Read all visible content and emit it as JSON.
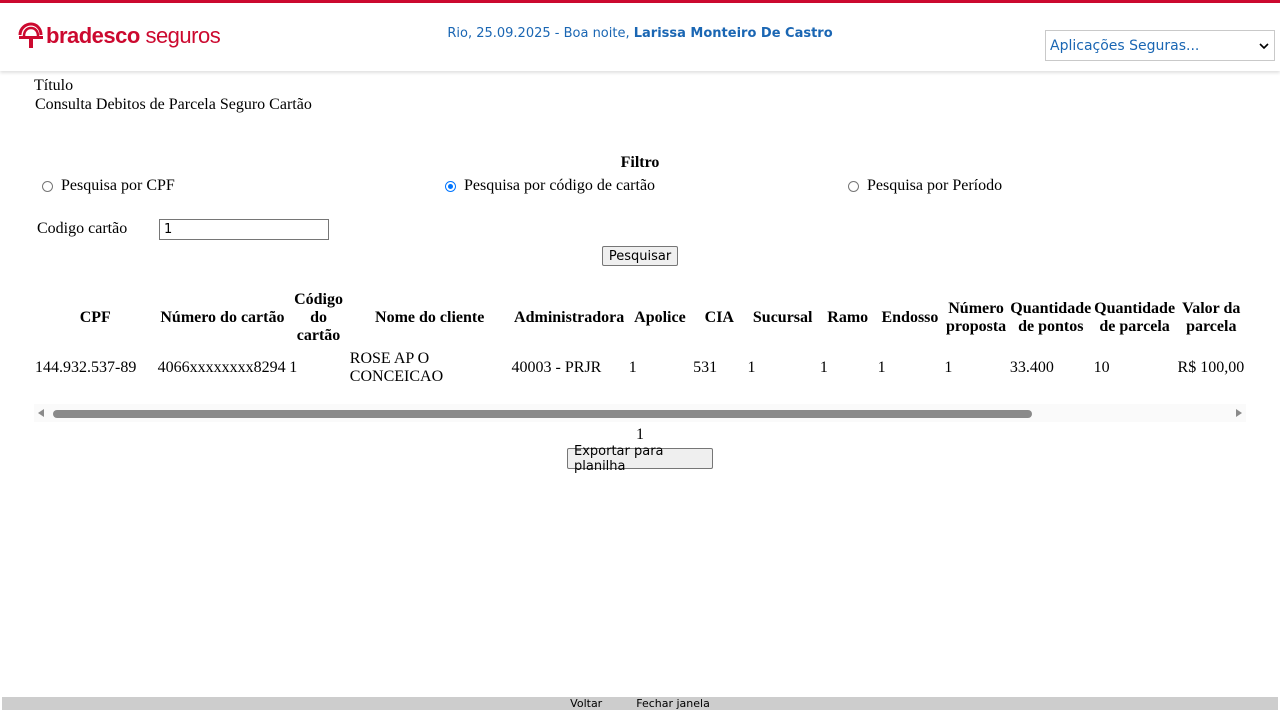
{
  "header": {
    "brand_bold": "bradesco",
    "brand_light": " seguros",
    "greeting_prefix": "Rio, 25.09.2025 - Boa noite, ",
    "user_name": "Larissa Monteiro De Castro",
    "apps_select_value": "Aplicações Seguras...",
    "brand_color": "#cc092f",
    "accent_color": "#1a66b3"
  },
  "page": {
    "title_image_alt": "Título",
    "subtitle": "Consulta Debitos de Parcela Seguro Cartão"
  },
  "filter": {
    "heading": "Filtro",
    "options": [
      {
        "label": "Pesquisa por CPF",
        "checked": false
      },
      {
        "label": "Pesquisa por código de cartão",
        "checked": true
      },
      {
        "label": "Pesquisa por Período",
        "checked": false
      }
    ],
    "codigo_label": "Codigo cartão",
    "codigo_value": "1",
    "search_button": "Pesquisar"
  },
  "table": {
    "headers": [
      "CPF",
      "Número do cartão",
      "Código do cartão",
      "Nome do cliente",
      "Administradora",
      "Apolice",
      "CIA",
      "Sucursal",
      "Ramo",
      "Endosso",
      "Número proposta",
      "Quantidade de pontos",
      "Quantidade de parcela",
      "Valor da parcela"
    ],
    "rows": [
      [
        "144.932.537-89",
        "4066xxxxxxxx8294",
        "1",
        "ROSE AP O CONCEICAO",
        "40003 - PRJR",
        "1",
        "531",
        "1",
        "1",
        "1",
        "1",
        "33.400",
        "10",
        "R$ 100,00"
      ]
    ]
  },
  "pager": {
    "current": "1"
  },
  "export_button": "Exportar para planilha",
  "footer": {
    "back": "Voltar",
    "close": "Fechar janela"
  }
}
